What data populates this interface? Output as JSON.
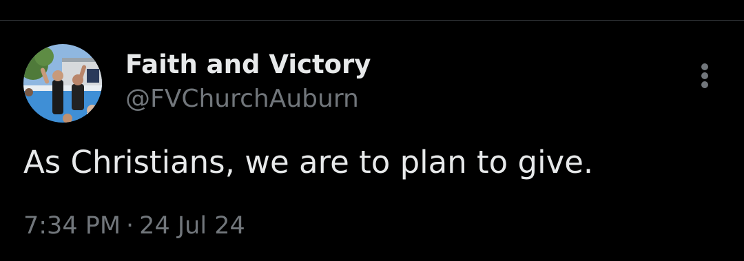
{
  "tweet": {
    "display_name": "Faith and Victory",
    "handle": "@FVChurchAuburn",
    "text": "As Christians, we are to plan to give.",
    "time": "7:34 PM",
    "separator": "·",
    "date": "24 Jul 24",
    "more_icon": "more-vertical-icon",
    "colors": {
      "background": "#000000",
      "primary_text": "#e7e9ea",
      "secondary_text": "#71767b",
      "divider": "#2f3336"
    }
  }
}
